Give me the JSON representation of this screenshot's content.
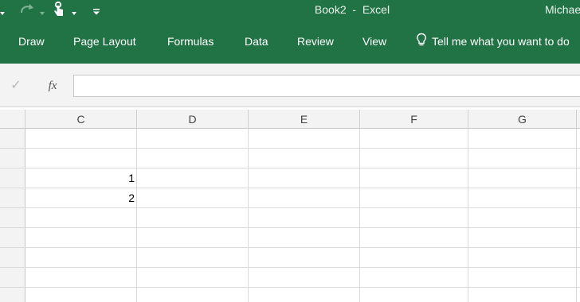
{
  "window": {
    "title": "Book2  -  Excel",
    "user": "Michael"
  },
  "quick_access": {
    "icons": [
      "undo-dropdown-icon",
      "redo-icon",
      "redo-dropdown-icon",
      "touch-mode-icon",
      "touch-dropdown-icon",
      "customize-qat-icon"
    ]
  },
  "ribbon": {
    "tabs": [
      "Draw",
      "Page Layout",
      "Formulas",
      "Data",
      "Review",
      "View"
    ],
    "tell_me": "Tell me what you want to do"
  },
  "formula_bar": {
    "enter_symbol": "✓",
    "function_symbol": "fx",
    "value": ""
  },
  "columns": [
    "C",
    "D",
    "E",
    "F",
    "G"
  ],
  "cells": [
    {
      "ref": "C3",
      "value": "1"
    },
    {
      "ref": "C4",
      "value": "2"
    }
  ],
  "colors": {
    "excel_green": "#217346",
    "header_gray": "#f3f3f3",
    "gridline": "#dadada"
  }
}
